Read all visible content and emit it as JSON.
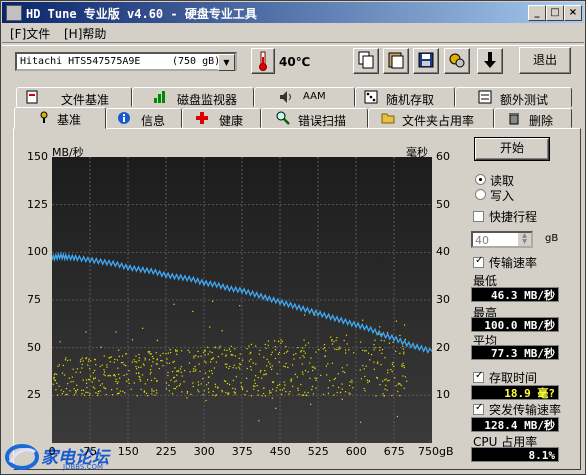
{
  "window": {
    "title": "HD Tune 专业版 v4.60 - 硬盘专业工具"
  },
  "titlebar_buttons": [
    "_",
    "□",
    "×"
  ],
  "menu": [
    "[F]文件",
    "[H]帮助"
  ],
  "toolbar": {
    "drive": "Hitachi HTS547575A9E",
    "capacity": "(750 gB)",
    "temperature": "40℃",
    "exit_label": "退出"
  },
  "tabs_top": [
    "文件基准",
    "磁盘监视器",
    "AAM",
    "随机存取",
    "额外测试"
  ],
  "tabs_bottom": [
    "基准",
    "信息",
    "健康",
    "错误扫描",
    "文件夹占用率",
    "删除"
  ],
  "chart_data": {
    "type": "line",
    "left_unit": "MB/秒",
    "right_unit": "毫秒",
    "x_ticks": [
      0,
      75,
      150,
      225,
      300,
      375,
      450,
      525,
      600,
      675,
      "750gB"
    ],
    "y_ticks_left": [
      150,
      125,
      100,
      75,
      50,
      25
    ],
    "y_ticks_right": [
      60,
      50,
      40,
      30,
      20,
      10
    ],
    "ylim_left": [
      0,
      150
    ],
    "ylim_right": [
      0,
      60
    ],
    "xlim": [
      0,
      750
    ],
    "series": [
      {
        "kind": "transfer-rate-line",
        "color": "#3fa9f5",
        "points": [
          [
            0,
            97
          ],
          [
            15,
            98
          ],
          [
            30,
            97.5
          ],
          [
            50,
            97
          ],
          [
            75,
            96
          ],
          [
            100,
            95
          ],
          [
            125,
            94
          ],
          [
            150,
            92
          ],
          [
            175,
            91
          ],
          [
            200,
            90
          ],
          [
            225,
            88
          ],
          [
            250,
            87
          ],
          [
            275,
            86
          ],
          [
            300,
            84
          ],
          [
            325,
            83
          ],
          [
            350,
            81
          ],
          [
            375,
            80
          ],
          [
            400,
            78
          ],
          [
            425,
            76
          ],
          [
            450,
            74
          ],
          [
            475,
            72
          ],
          [
            500,
            70
          ],
          [
            525,
            68
          ],
          [
            550,
            66
          ],
          [
            575,
            64
          ],
          [
            600,
            62
          ],
          [
            625,
            60
          ],
          [
            650,
            57
          ],
          [
            675,
            55
          ],
          [
            700,
            52
          ],
          [
            725,
            50
          ],
          [
            750,
            48
          ]
        ]
      },
      {
        "kind": "access-time-scatter",
        "color": "#e6e600",
        "band_y": [
          10,
          24
        ]
      }
    ]
  },
  "controls": {
    "start_label": "开始",
    "read_label": "读取",
    "write_label": "写入",
    "quick_label": "快捷行程",
    "quick_value": "40",
    "quick_unit": "gB",
    "transfer_label": "传输速率",
    "min_label": "最低",
    "min_value": "46.3 MB/秒",
    "max_label": "最高",
    "max_value": "100.0 MB/秒",
    "avg_label": "平均",
    "avg_value": "77.3 MB/秒",
    "access_label": "存取时间",
    "access_value": "18.9 毫?",
    "burst_label": "突发传输速率",
    "burst_value": "128.4 MB/秒",
    "cpu_label": "CPU 占用率",
    "cpu_value": "8.1%"
  },
  "watermark": {
    "text": "家电论坛",
    "sub": "JDBBS.COM"
  }
}
